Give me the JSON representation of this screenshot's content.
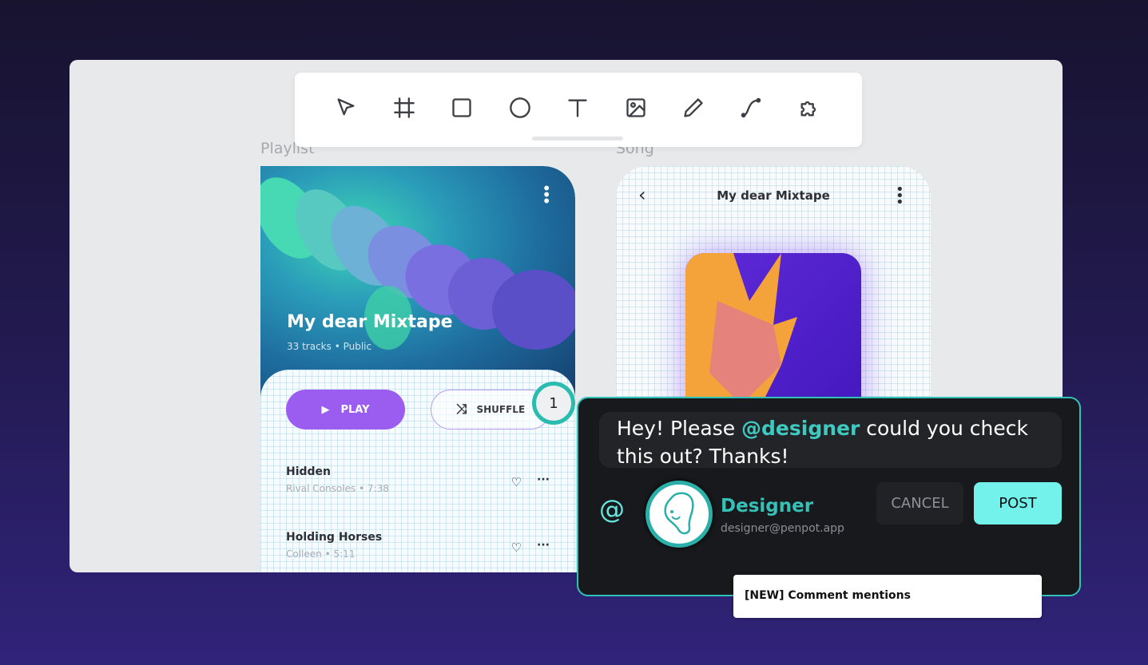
{
  "toolbar": {
    "tools": [
      "move",
      "board",
      "rectangle",
      "ellipse",
      "text",
      "image",
      "pencil",
      "path",
      "plugins"
    ]
  },
  "boards": {
    "playlist_label": "Playlist",
    "song_label": "Song"
  },
  "playlist": {
    "title": "My dear Mixtape",
    "subtitle": "33 tracks • Public",
    "play_label": "PLAY",
    "shuffle_label": "SHUFFLE",
    "tracks": [
      {
        "title": "Hidden",
        "artist": "Rival Consoles",
        "duration": "7:38",
        "sep": "•"
      },
      {
        "title": "Holding Horses",
        "artist": "Colleen",
        "duration": "5:11",
        "sep": "•"
      }
    ]
  },
  "song": {
    "title": "My dear Mixtape"
  },
  "comment": {
    "pin_number": "1",
    "text_before": "Hey! Please ",
    "mention": "@designer",
    "text_after": " could you check this out? Thanks!",
    "at_symbol": "@",
    "user_name": "Designer",
    "user_email": "designer@penpot.app",
    "cancel_label": "CANCEL",
    "post_label": "POST"
  },
  "toast": {
    "text": "[NEW] Comment mentions"
  },
  "colors": {
    "accent": "#2fc3b7",
    "post": "#72f2ea",
    "play": "#9b5cf0"
  }
}
